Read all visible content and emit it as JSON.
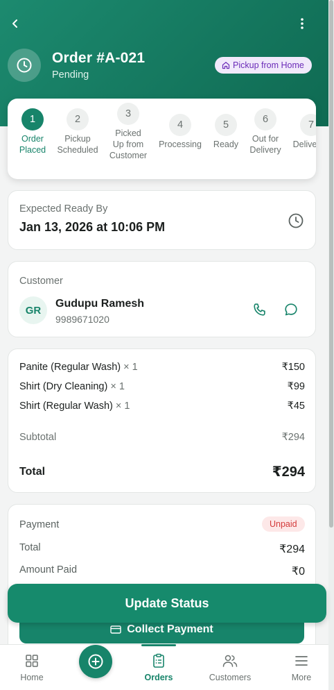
{
  "header": {
    "order_title": "Order #A-021",
    "order_status": "Pending",
    "pickup_badge": "Pickup from Home"
  },
  "stepper": {
    "steps": [
      {
        "number": "1",
        "label_lines": [
          "Order",
          "Placed"
        ],
        "active": true
      },
      {
        "number": "2",
        "label_lines": [
          "Pickup",
          "Scheduled"
        ],
        "active": false
      },
      {
        "number": "3",
        "label_lines": [
          "Picked",
          "Up from",
          "Customer"
        ],
        "active": false
      },
      {
        "number": "4",
        "label_lines": [
          "Processing"
        ],
        "active": false
      },
      {
        "number": "5",
        "label_lines": [
          "Ready"
        ],
        "active": false
      },
      {
        "number": "6",
        "label_lines": [
          "Out for",
          "Delivery"
        ],
        "active": false
      },
      {
        "number": "7",
        "label_lines": [
          "Delivered"
        ],
        "active": false
      }
    ]
  },
  "ready": {
    "label": "Expected Ready By",
    "date": "Jan 13, 2026 at 10:06 PM"
  },
  "customer": {
    "label": "Customer",
    "initials": "GR",
    "name": "Gudupu Ramesh",
    "phone": "9989671020"
  },
  "items": {
    "lines": [
      {
        "name": "Panite (Regular Wash)",
        "qty": "× 1",
        "price": "₹150"
      },
      {
        "name": "Shirt (Dry Cleaning)",
        "qty": "× 1",
        "price": "₹99"
      },
      {
        "name": "Shirt (Regular Wash)",
        "qty": "× 1",
        "price": "₹45"
      }
    ],
    "subtotal_label": "Subtotal",
    "subtotal_value": "₹294",
    "total_label": "Total",
    "total_value": "₹294"
  },
  "payment": {
    "label": "Payment",
    "status_badge": "Unpaid",
    "total_label": "Total",
    "total_value": "₹294",
    "paid_label": "Amount Paid",
    "paid_value": "₹0"
  },
  "actions": {
    "update_status": "Update Status",
    "collect_payment": "Collect Payment"
  },
  "nav": {
    "items": [
      {
        "label": "Home",
        "icon": "grid-icon"
      },
      {
        "label": "",
        "icon": "plus-circle-icon"
      },
      {
        "label": "Orders",
        "icon": "clipboard-icon"
      },
      {
        "label": "Customers",
        "icon": "users-icon"
      },
      {
        "label": "More",
        "icon": "menu-icon"
      }
    ]
  },
  "colors": {
    "primary": "#17846a",
    "header_gradient_start": "#1c8a6f",
    "unpaid_red": "#d33a3a",
    "badge_purple": "#6b2bb8"
  }
}
